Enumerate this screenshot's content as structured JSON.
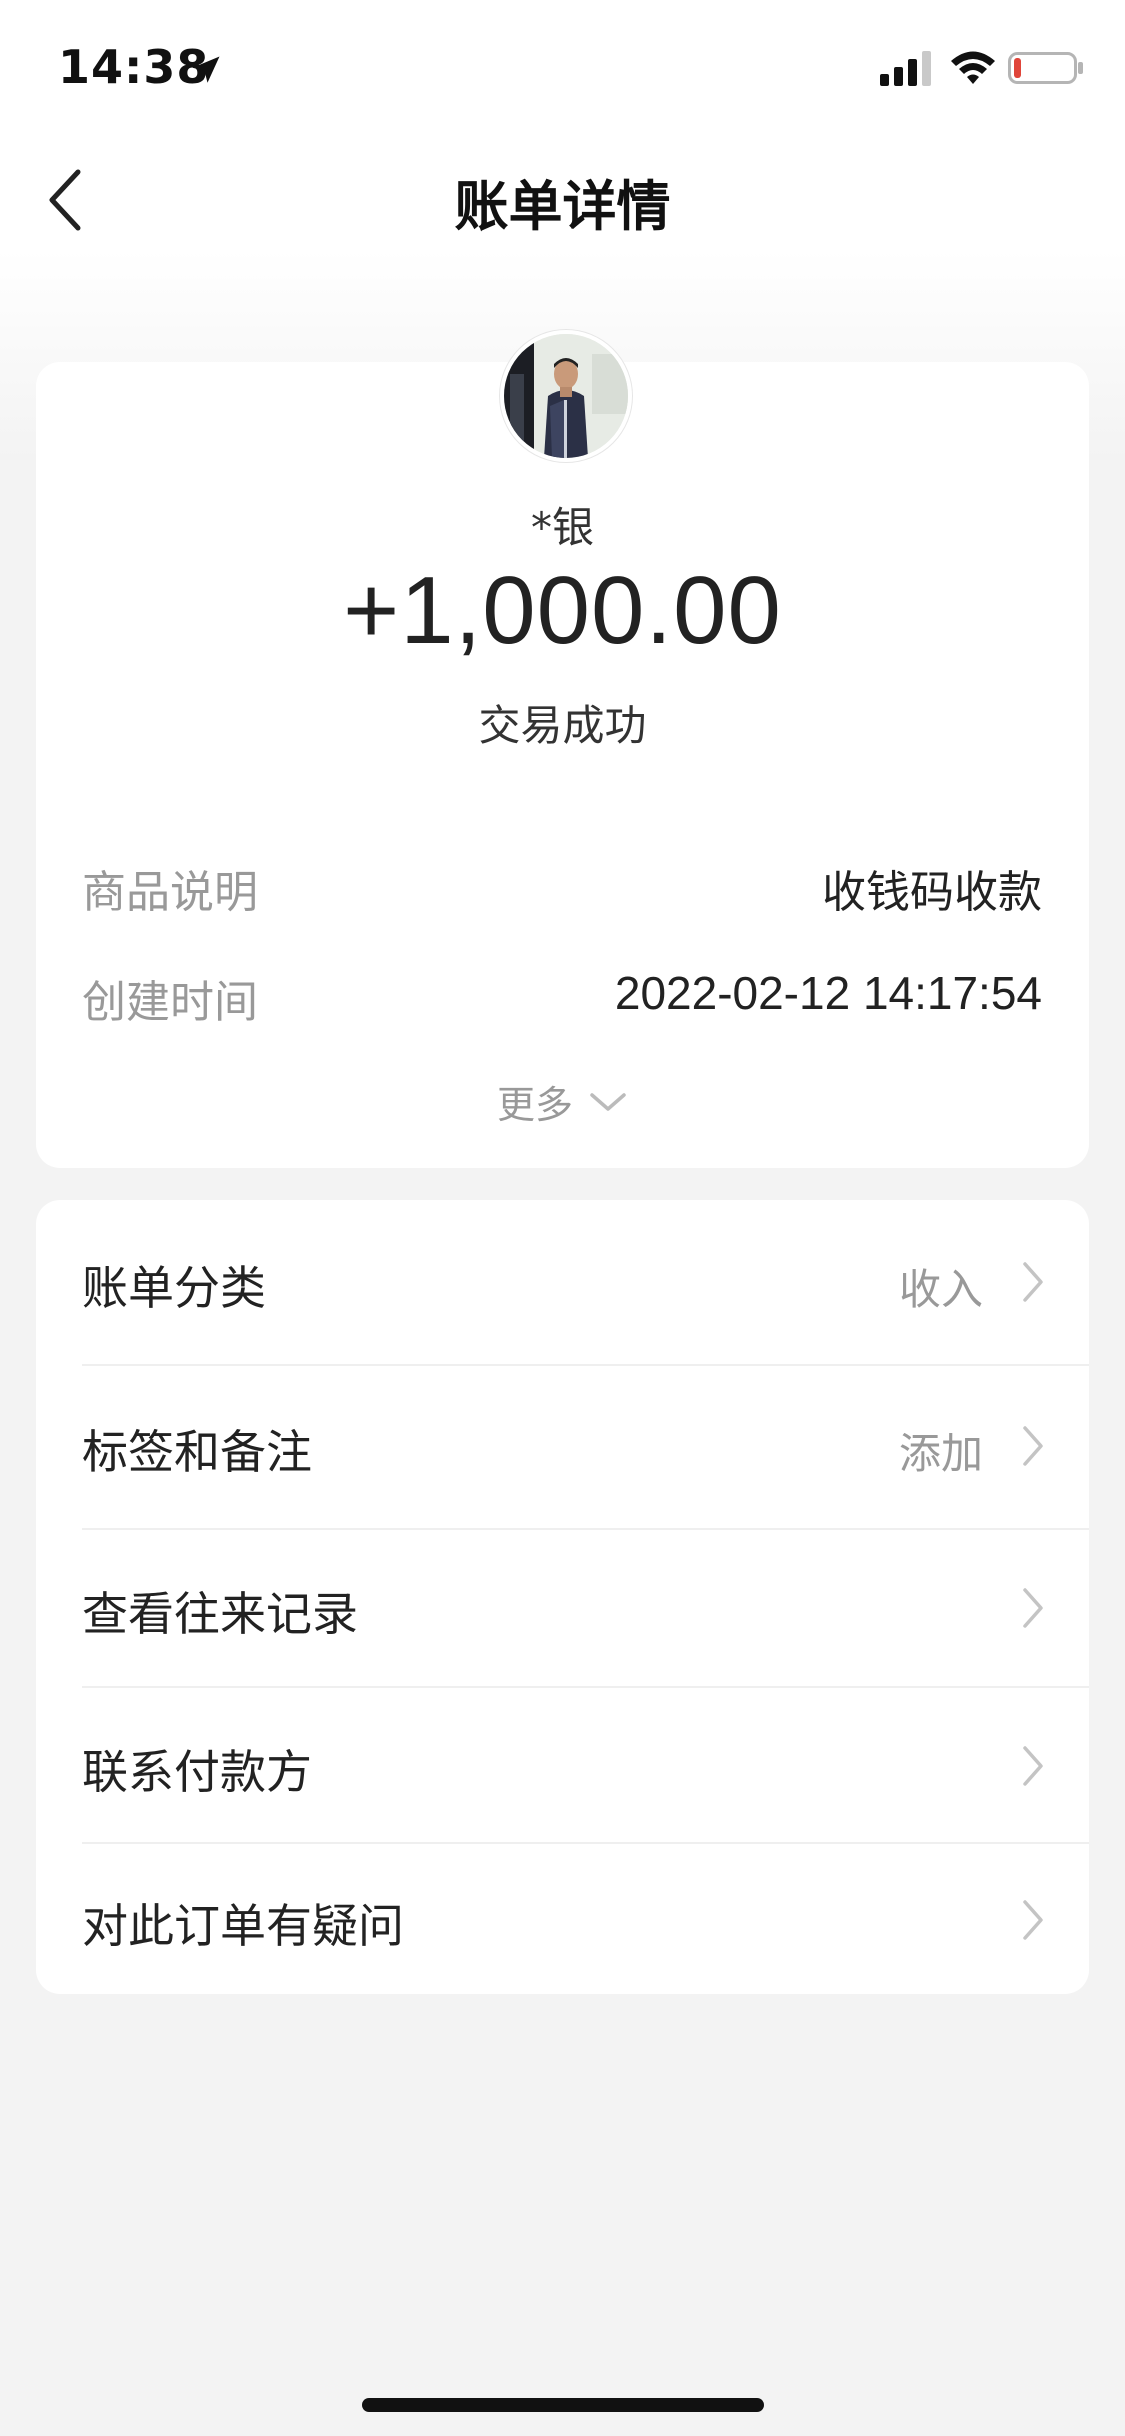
{
  "status_bar": {
    "time": "14:38"
  },
  "nav": {
    "title": "账单详情"
  },
  "summary": {
    "payer_name": "*银",
    "amount": "+1,000.00",
    "status": "交易成功",
    "details": [
      {
        "label": "商品说明",
        "value": "收钱码收款"
      },
      {
        "label": "创建时间",
        "value": "2022-02-12 14:17:54"
      }
    ],
    "more_label": "更多"
  },
  "menu": {
    "items": [
      {
        "label": "账单分类",
        "value": "收入"
      },
      {
        "label": "标签和备注",
        "value": "添加"
      },
      {
        "label": "查看往来记录",
        "value": ""
      },
      {
        "label": "联系付款方",
        "value": ""
      },
      {
        "label": "对此订单有疑问",
        "value": ""
      }
    ]
  },
  "colors": {
    "background": "#f3f3f3",
    "card": "#ffffff",
    "primary_text": "#222222",
    "secondary_text": "#999999",
    "battery_low": "#e0453a"
  }
}
